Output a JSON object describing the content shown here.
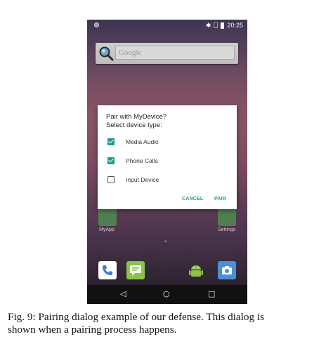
{
  "status_bar": {
    "time": "20:25",
    "icons": [
      "notification-dot-icon",
      "bluetooth-icon",
      "no-sim-icon",
      "battery-icon"
    ],
    "bluetooth_glyph": "✱"
  },
  "search": {
    "placeholder": "Google"
  },
  "home": {
    "apps": [
      {
        "label": "MyApp"
      },
      {
        "label": "Settings"
      }
    ],
    "dock_icons": [
      "phone-icon",
      "messaging-icon",
      "android-icon",
      "camera-icon"
    ]
  },
  "dialog": {
    "title_line1": "Pair with MyDevice?",
    "title_line2": "Select device type:",
    "options": [
      {
        "label": "Media Audio",
        "checked": true
      },
      {
        "label": "Phone Calls",
        "checked": true
      },
      {
        "label": "Input Device",
        "checked": false
      }
    ],
    "cancel_label": "CANCEL",
    "pair_label": "PAIR",
    "accent_color": "#1e9b8f"
  },
  "nav": {
    "back_glyph": "◁",
    "home_glyph": "○",
    "recent_glyph": "□",
    "up_glyph": "⌃"
  },
  "caption": {
    "line1": "Fig. 9: Pairing dialog example of our defense. This dialog is",
    "line2": "shown when a pairing process happens."
  }
}
